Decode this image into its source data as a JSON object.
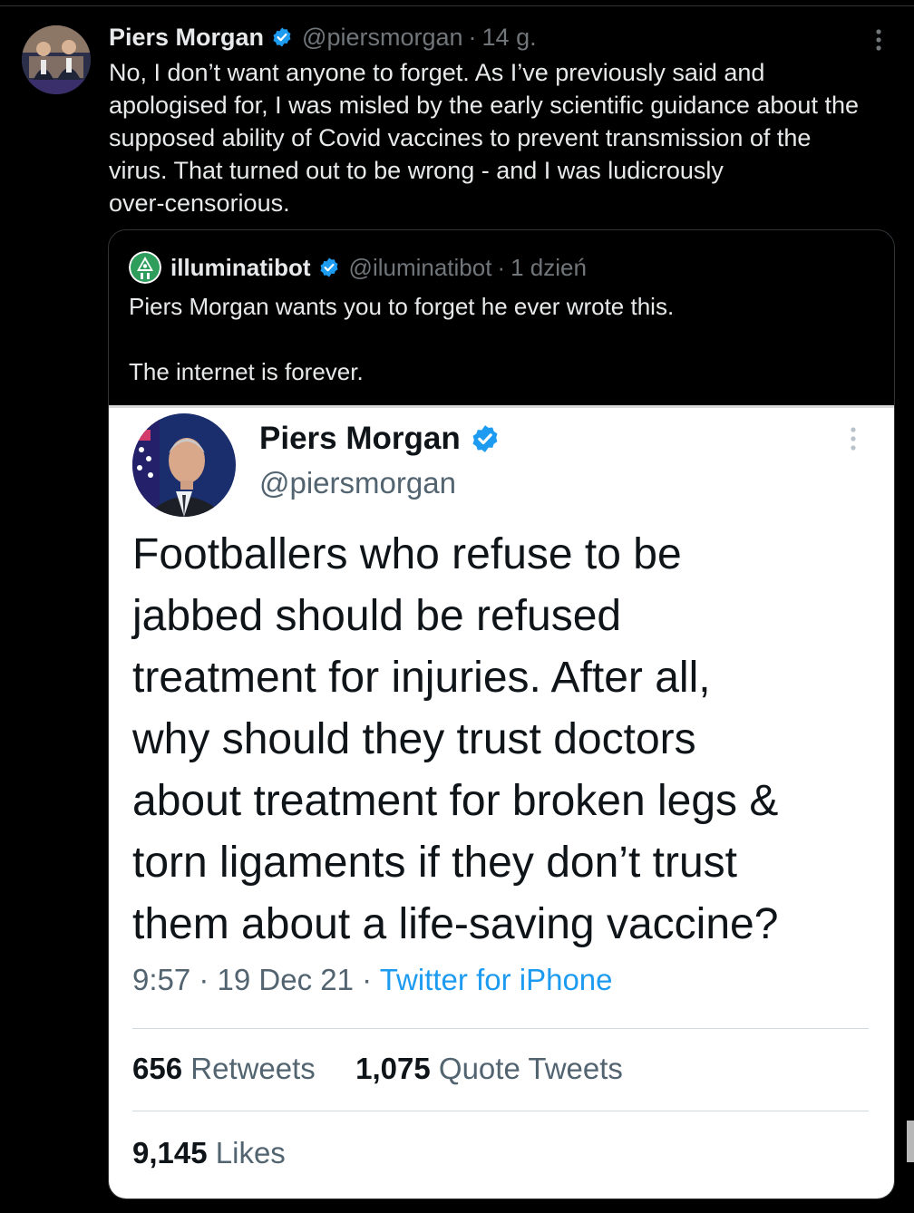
{
  "outer_tweet": {
    "author_name": "Piers Morgan",
    "handle": "@piersmorgan",
    "separator": "·",
    "time": "14 g.",
    "text_lines": [
      "No, I don’t want anyone to forget. As I’ve previously said and",
      "apologised for, I was misled by the early scientific guidance about the",
      "supposed ability of Covid vaccines to prevent transmission of the",
      "virus. That turned out to be wrong - and I was ludicrously",
      "over-censorious."
    ],
    "verified_icon": "verified-badge-icon",
    "more_icon": "more-vertical-icon"
  },
  "quoted_tweet": {
    "author_name": "illuminatibot",
    "handle": "@iluminatibot",
    "separator": "·",
    "time": "1 dzień",
    "text_lines": [
      "Piers Morgan wants you to forget he ever wrote this.",
      "The internet is forever."
    ],
    "verified_icon": "verified-badge-icon"
  },
  "embedded_screenshot": {
    "author_name": "Piers Morgan",
    "handle": "@piersmorgan",
    "text_lines": [
      "Footballers who refuse to be",
      "jabbed should be refused",
      "treatment for injuries. After all,",
      "why should they trust doctors",
      "about treatment for broken legs &",
      "torn ligaments if they don’t trust",
      "them about a life-saving vaccine?"
    ],
    "timestamp": "9:57 · 19 Dec 21 · ",
    "source": "Twitter for iPhone",
    "retweets_count": "656",
    "retweets_label": "Retweets",
    "quotes_count": "1,075",
    "quotes_label": "Quote Tweets",
    "likes_count": "9,145",
    "likes_label": "Likes"
  },
  "colors": {
    "background": "#000000",
    "text_primary": "#e7e9ea",
    "text_secondary": "#71767b",
    "verified_blue": "#1d9bf0",
    "screenshot_background": "#ffffff",
    "screenshot_link": "#1d9bf0"
  }
}
